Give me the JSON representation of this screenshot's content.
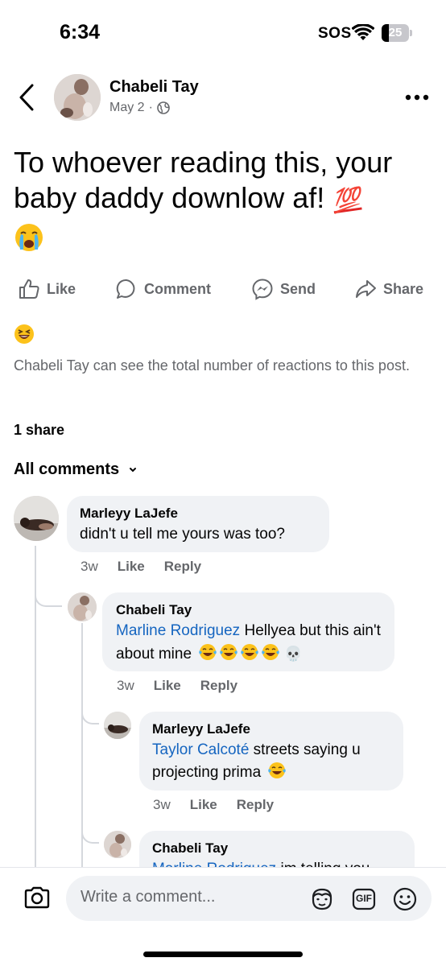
{
  "status_bar": {
    "time": "6:34",
    "carrier": "SOS",
    "battery": "25",
    "battery_level": 0.25,
    "icons": [
      "wifi-icon",
      "battery-icon"
    ]
  },
  "post": {
    "author": "Chabeli Tay",
    "date": "May 2",
    "separator": "·",
    "audience_icon": "globe-icon",
    "text": "To whoever reading this, your baby daddy downlow af!",
    "text_emoji": "💯",
    "text_emoji_2": "loudly-crying-face-emoji",
    "reaction_emoji": "grinning-squinting-face-emoji",
    "reaction_note": "Chabeli Tay can see the total number of reactions to this post.",
    "shares": "1 share"
  },
  "actions": {
    "like": "Like",
    "comment": "Comment",
    "send": "Send",
    "share": "Share"
  },
  "comments_filter": "All comments",
  "comments": [
    {
      "author": "Marleyy LaJefe",
      "mention": "",
      "text": "didn't u tell me yours was too?",
      "time": "3w",
      "like": "Like",
      "reply": "Reply"
    },
    {
      "author": "Chabeli Tay",
      "mention": "Marline Rodriguez",
      "text": "Hellyea but this ain't about mine",
      "emojis": "laughing-emoji x4, skull-emoji",
      "skull": "💀",
      "time": "3w",
      "like": "Like",
      "reply": "Reply"
    },
    {
      "author": "Marleyy LaJefe",
      "mention": "Taylor Calcoté",
      "text": "streets saying u projecting prima",
      "emojis": "laughing-emoji",
      "time": "3w",
      "like": "Like",
      "reply": "Reply"
    },
    {
      "author": "Chabeli Tay",
      "mention": "Marline Rodriguez",
      "text": "im telling you"
    }
  ],
  "composer": {
    "placeholder": "Write a comment...",
    "gif": "GIF"
  },
  "colors": {
    "mention": "#1565c0",
    "secondary_text": "#65676b",
    "bubble": "#f0f2f5"
  }
}
